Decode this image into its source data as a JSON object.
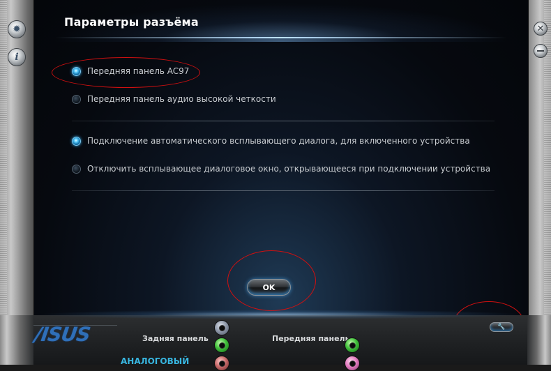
{
  "window": {
    "title": "Параметры разъёма"
  },
  "connector_options": [
    {
      "label": "Передняя панель AC97",
      "checked": true
    },
    {
      "label": "Передняя панель аудио высокой четкости",
      "checked": false
    }
  ],
  "popup_options": [
    {
      "label": "Подключение автоматического всплывающего диалога, для включенного устройства",
      "checked": true
    },
    {
      "label": "Отключить всплывающее диалоговое окно, открывающееся при подключении устройства",
      "checked": false
    }
  ],
  "ok_button": {
    "label": "OK"
  },
  "side_controls": {
    "left": [
      "gear-icon",
      "info-icon"
    ],
    "right": [
      "close-icon",
      "minimize-icon"
    ]
  },
  "bottom_bar": {
    "logo": "/ISUS",
    "rear_panel_label": "Задняя панель",
    "front_panel_label": "Передняя панель",
    "analog_label": "АНАЛОГОВЫЙ",
    "wrench_button_icon": "wrench-icon"
  },
  "colors": {
    "accent": "#38a9e8",
    "annotation": "#d01010",
    "logo": "#2f6fb8"
  }
}
